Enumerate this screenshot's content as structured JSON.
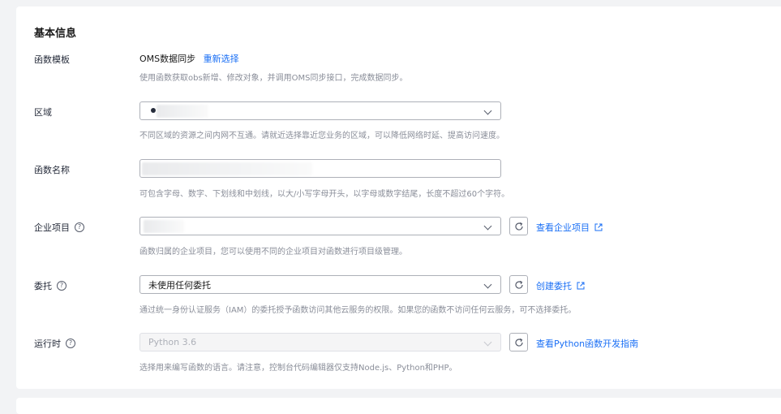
{
  "section": {
    "title": "基本信息"
  },
  "template": {
    "label": "函数模板",
    "value": "OMS数据同步",
    "reselect": "重新选择",
    "hint": "使用函数获取obs新增、修改对象，并调用OMS同步接口，完成数据同步。"
  },
  "region": {
    "label": "区域",
    "hint": "不同区域的资源之间内网不互通。请就近选择靠近您业务的区域，可以降低网络时延、提高访问速度。"
  },
  "function_name": {
    "label": "函数名称",
    "hint": "可包含字母、数字、下划线和中划线，以大/小写字母开头，以字母或数字结尾，长度不超过60个字符。"
  },
  "enterprise_project": {
    "label": "企业项目",
    "link": "查看企业项目",
    "hint": "函数归属的企业项目，您可以使用不同的企业项目对函数进行项目级管理。"
  },
  "agency": {
    "label": "委托",
    "value": "未使用任何委托",
    "link": "创建委托",
    "hint": "通过统一身份认证服务（IAM）的委托授予函数访问其他云服务的权限。如果您的函数不访问任何云服务，可不选择委托。"
  },
  "runtime": {
    "label": "运行时",
    "value": "Python 3.6",
    "link": "查看Python函数开发指南",
    "hint": "选择用来编写函数的语言。请注意，控制台代码编辑器仅支持Node.js、Python和PHP。"
  },
  "icons": {
    "help": "help-circle-icon",
    "refresh": "refresh-icon",
    "external": "external-link-icon",
    "dropdown": "chevron-down-icon"
  },
  "colors": {
    "link": "#1a6ff5",
    "hint": "#8a8e99",
    "border": "#adb0b8"
  }
}
